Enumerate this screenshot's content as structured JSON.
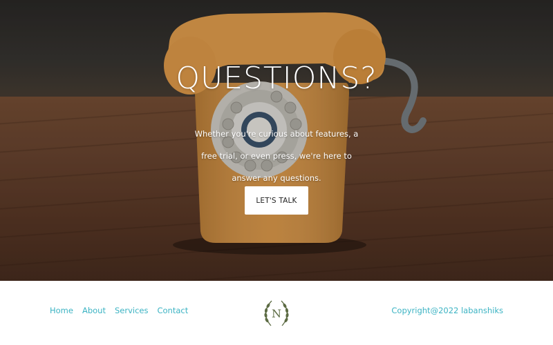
{
  "hero": {
    "title": "QUESTIONS?",
    "text": "Whether you're curious about features, a free trial, or even press, we're here to answer any questions.",
    "cta_label": "LET'S TALK"
  },
  "footer": {
    "nav": [
      {
        "label": "Home"
      },
      {
        "label": "About"
      },
      {
        "label": "Services"
      },
      {
        "label": "Contact"
      }
    ],
    "logo_letter": "N",
    "copyright": "Copyright@2022 labanshiks"
  },
  "colors": {
    "accent": "#3bb3c3",
    "logo_green": "#5c6b43",
    "phone_orange": "#e39a44"
  },
  "icons": {
    "logo": "laurel-wreath-n-logo",
    "hero_image": "orange-rotary-telephone-photo"
  }
}
